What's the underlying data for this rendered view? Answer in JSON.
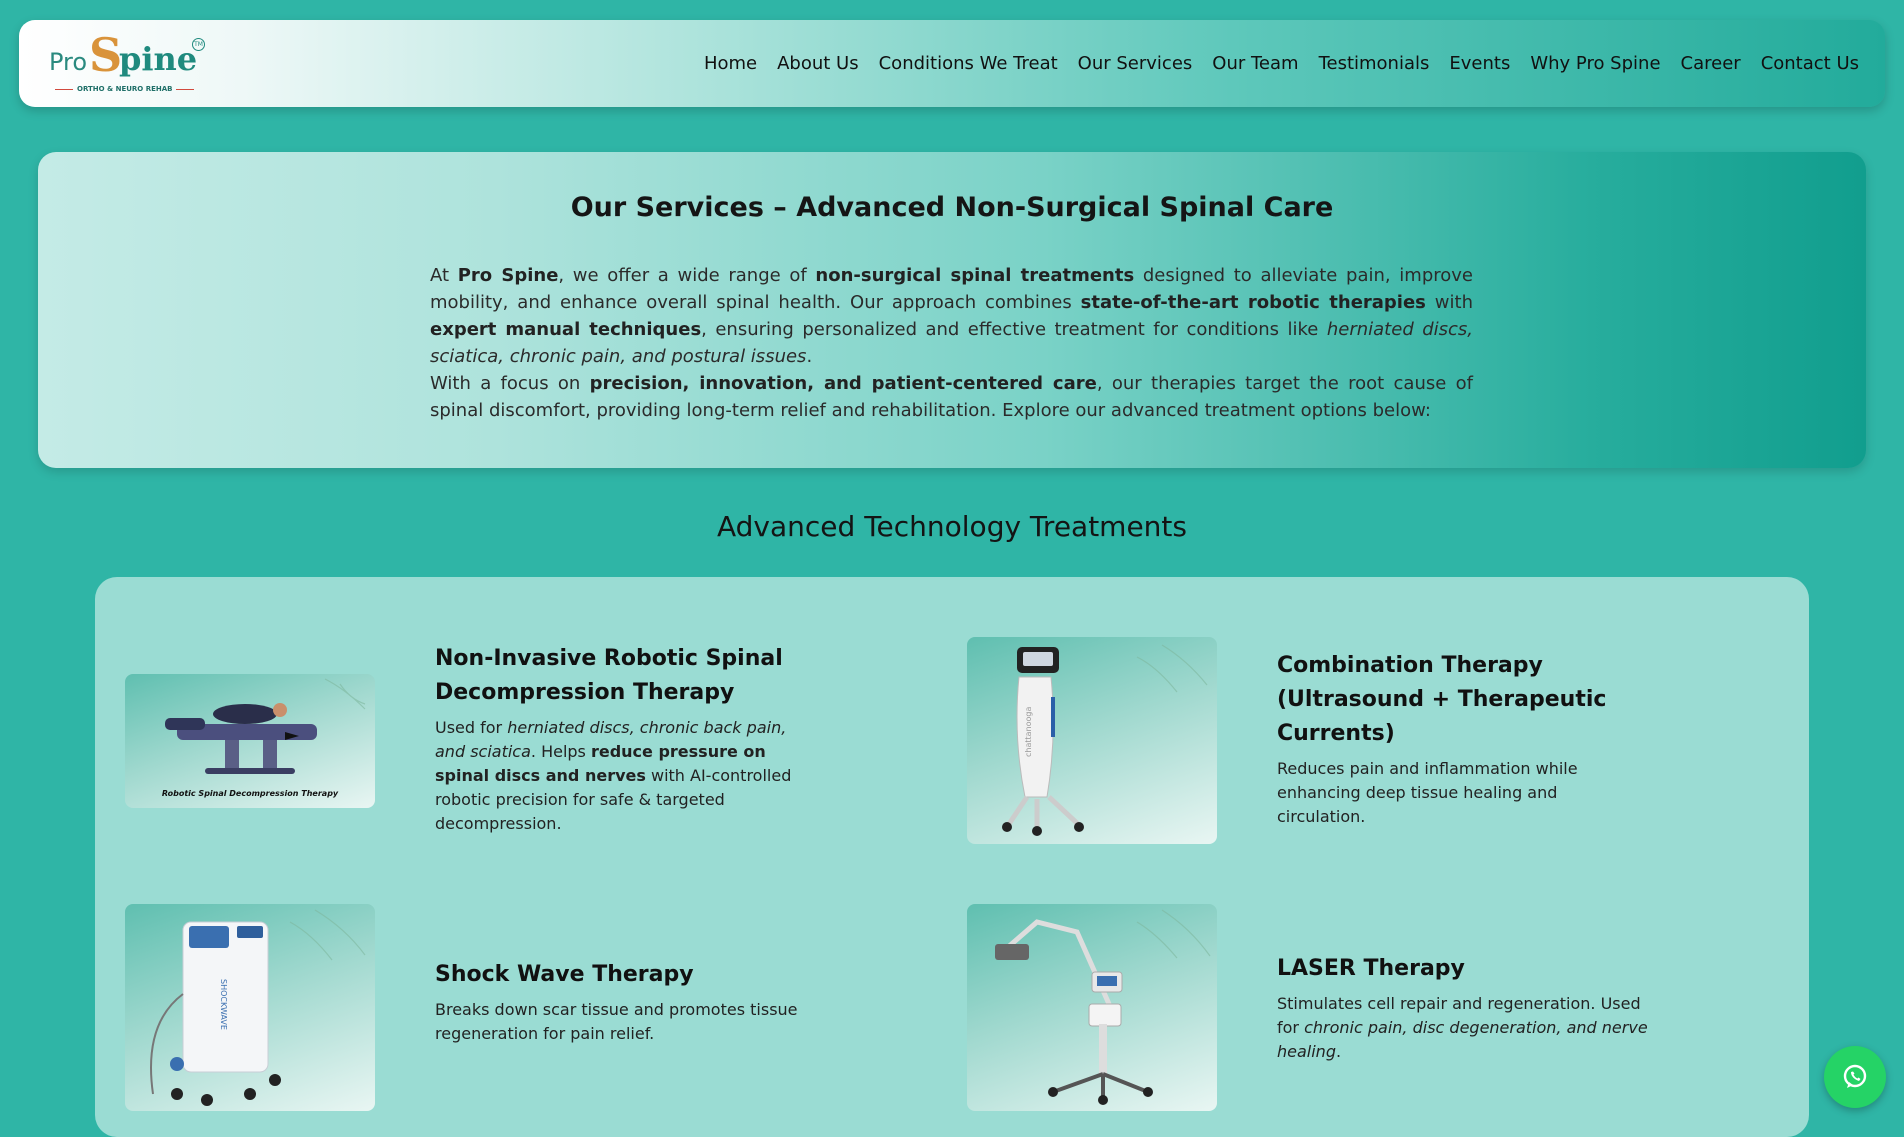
{
  "brand": {
    "logo_pro": "Pro",
    "logo_s": "S",
    "logo_pine": "pine",
    "logo_tm": "TM",
    "tagline": "ORTHO & NEURO REHAB"
  },
  "nav": {
    "items": [
      "Home",
      "About Us",
      "Conditions We Treat",
      "Our Services",
      "Our Team",
      "Testimonials",
      "Events",
      "Why Pro Spine",
      "Career",
      "Contact Us"
    ]
  },
  "intro": {
    "title": "Our Services – Advanced Non-Surgical Spinal Care",
    "p1": {
      "t1": "At ",
      "b1": "Pro Spine",
      "t2": ", we offer a wide range of ",
      "b2": "non-surgical spinal treatments",
      "t3": " designed to alleviate pain, improve mobility, and enhance overall spinal health. Our approach combines ",
      "b3": "state-of-the-art robotic therapies",
      "t4": " with ",
      "b4": "expert manual techniques",
      "t5": ", ensuring personalized and effective treatment for conditions like ",
      "i1": "herniated discs, sciatica, chronic pain, and postural issues",
      "t6": "."
    },
    "p2": {
      "t1": "With a focus on ",
      "b1": "precision, innovation, and patient-centered care",
      "t2": ", our therapies target the root cause of spinal discomfort, providing long-term relief and rehabilitation. Explore our advanced treatment options below:"
    }
  },
  "section_heading": "Advanced Technology Treatments",
  "services": [
    {
      "title": "Non-Invasive Robotic Spinal Decompression Therapy",
      "image_caption": "Robotic Spinal Decompression Therapy",
      "desc": {
        "t1": "Used for ",
        "i1": "herniated discs, chronic back pain, and sciatica",
        "t2": ". Helps ",
        "b1": "reduce pressure on spinal discs and nerves",
        "t3": " with AI-controlled robotic precision for safe & targeted decompression."
      }
    },
    {
      "title": "Combination Therapy (Ultrasound + Therapeutic Currents)",
      "image_caption": "chattanooga",
      "desc": {
        "t1": "Reduces pain and inflammation while enhancing deep tissue healing and circulation."
      }
    },
    {
      "title": "Shock Wave Therapy",
      "image_caption": "SHOCKWAVE",
      "desc": {
        "t1": "Breaks down scar tissue and promotes tissue regeneration for pain relief."
      }
    },
    {
      "title": "LASER Therapy",
      "desc": {
        "t1": "Stimulates cell repair and regeneration. Used for ",
        "i1": "chronic pain, disc degeneration, and nerve healing",
        "t2": "."
      }
    }
  ],
  "icons": {
    "whatsapp": "whatsapp-icon"
  },
  "colors": {
    "page_background": "#2fb5a6",
    "panel_background": "#9adcd3",
    "whatsapp_green": "#25d366",
    "logo_orange": "#d9933a",
    "logo_teal": "#1f8a7e"
  }
}
